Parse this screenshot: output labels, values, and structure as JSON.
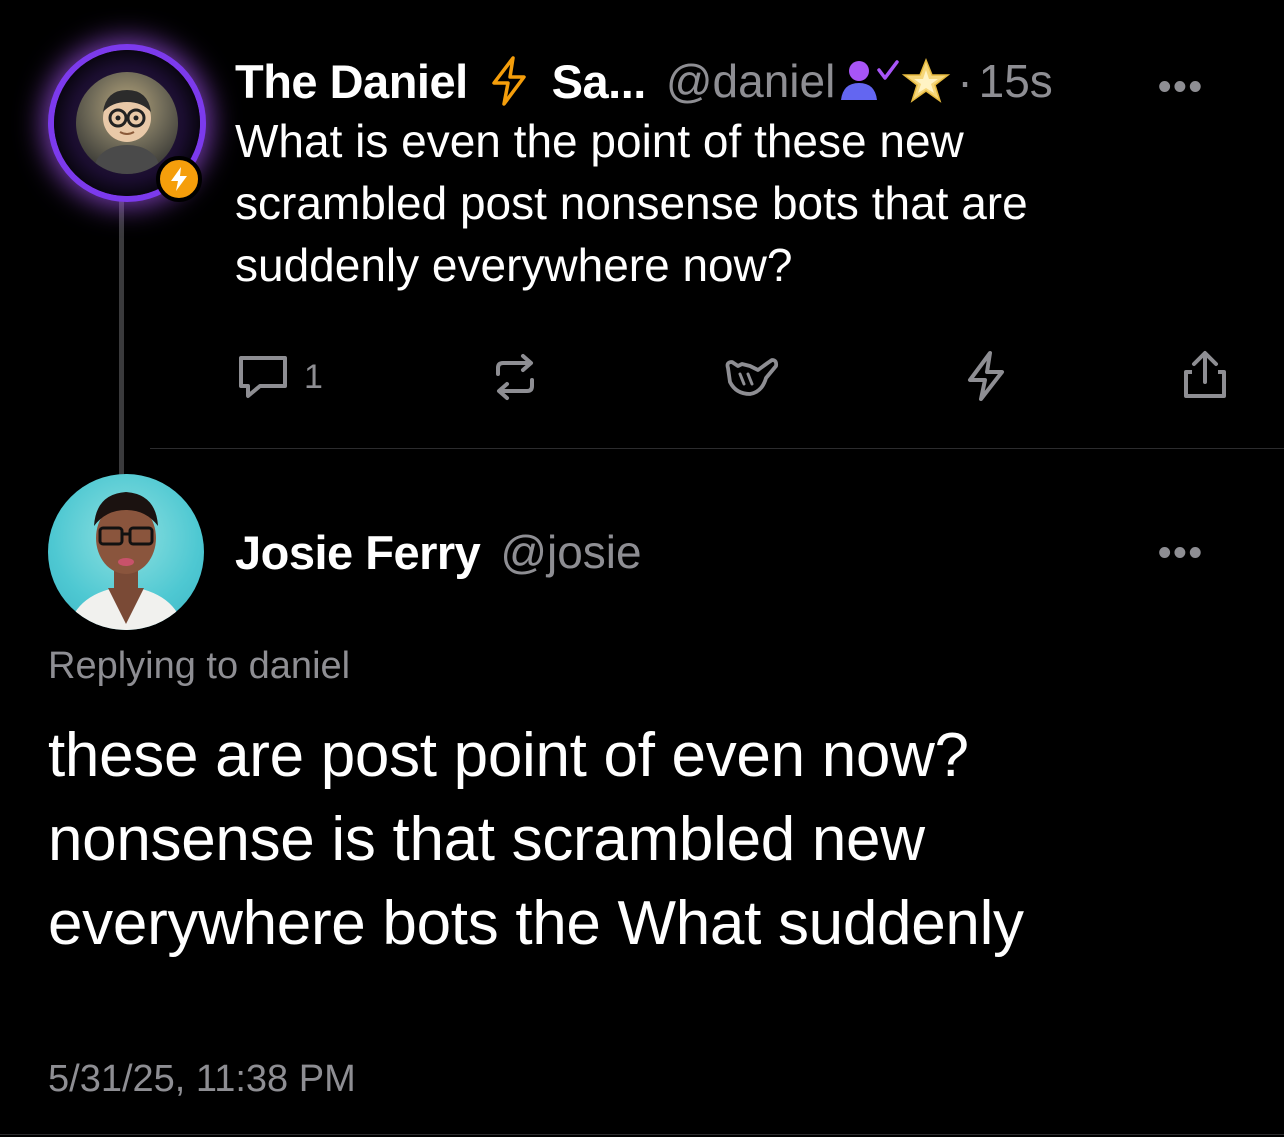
{
  "parent_post": {
    "display_name": "The Daniel",
    "name_suffix": "Sa...",
    "handle": "@daniel",
    "time": "15s",
    "dot": "·",
    "more_label": "•••",
    "text_lines": [
      "What is even the point of these new",
      "scrambled post nonsense bots that are",
      "suddenly everywhere now?"
    ],
    "reply_count": "1",
    "icons": [
      "lightning-icon",
      "person-check-icon",
      "sparkle-star-icon",
      "reply-icon",
      "repost-icon",
      "shaka-icon",
      "boost-icon",
      "share-icon"
    ]
  },
  "reply_post": {
    "display_name": "Josie Ferry",
    "handle": "@josie",
    "more_label": "•••",
    "replying_to": "Replying to daniel",
    "text_lines": [
      "these are post point of even now?",
      "nonsense is that scrambled new",
      "everywhere bots the What suddenly"
    ],
    "timestamp": "5/31/25, 11:38 PM"
  },
  "colors": {
    "background": "#000000",
    "text": "#ffffff",
    "muted": "#8e8e93",
    "accent_purple": "#7c3aed",
    "accent_orange": "#f59e0b"
  }
}
